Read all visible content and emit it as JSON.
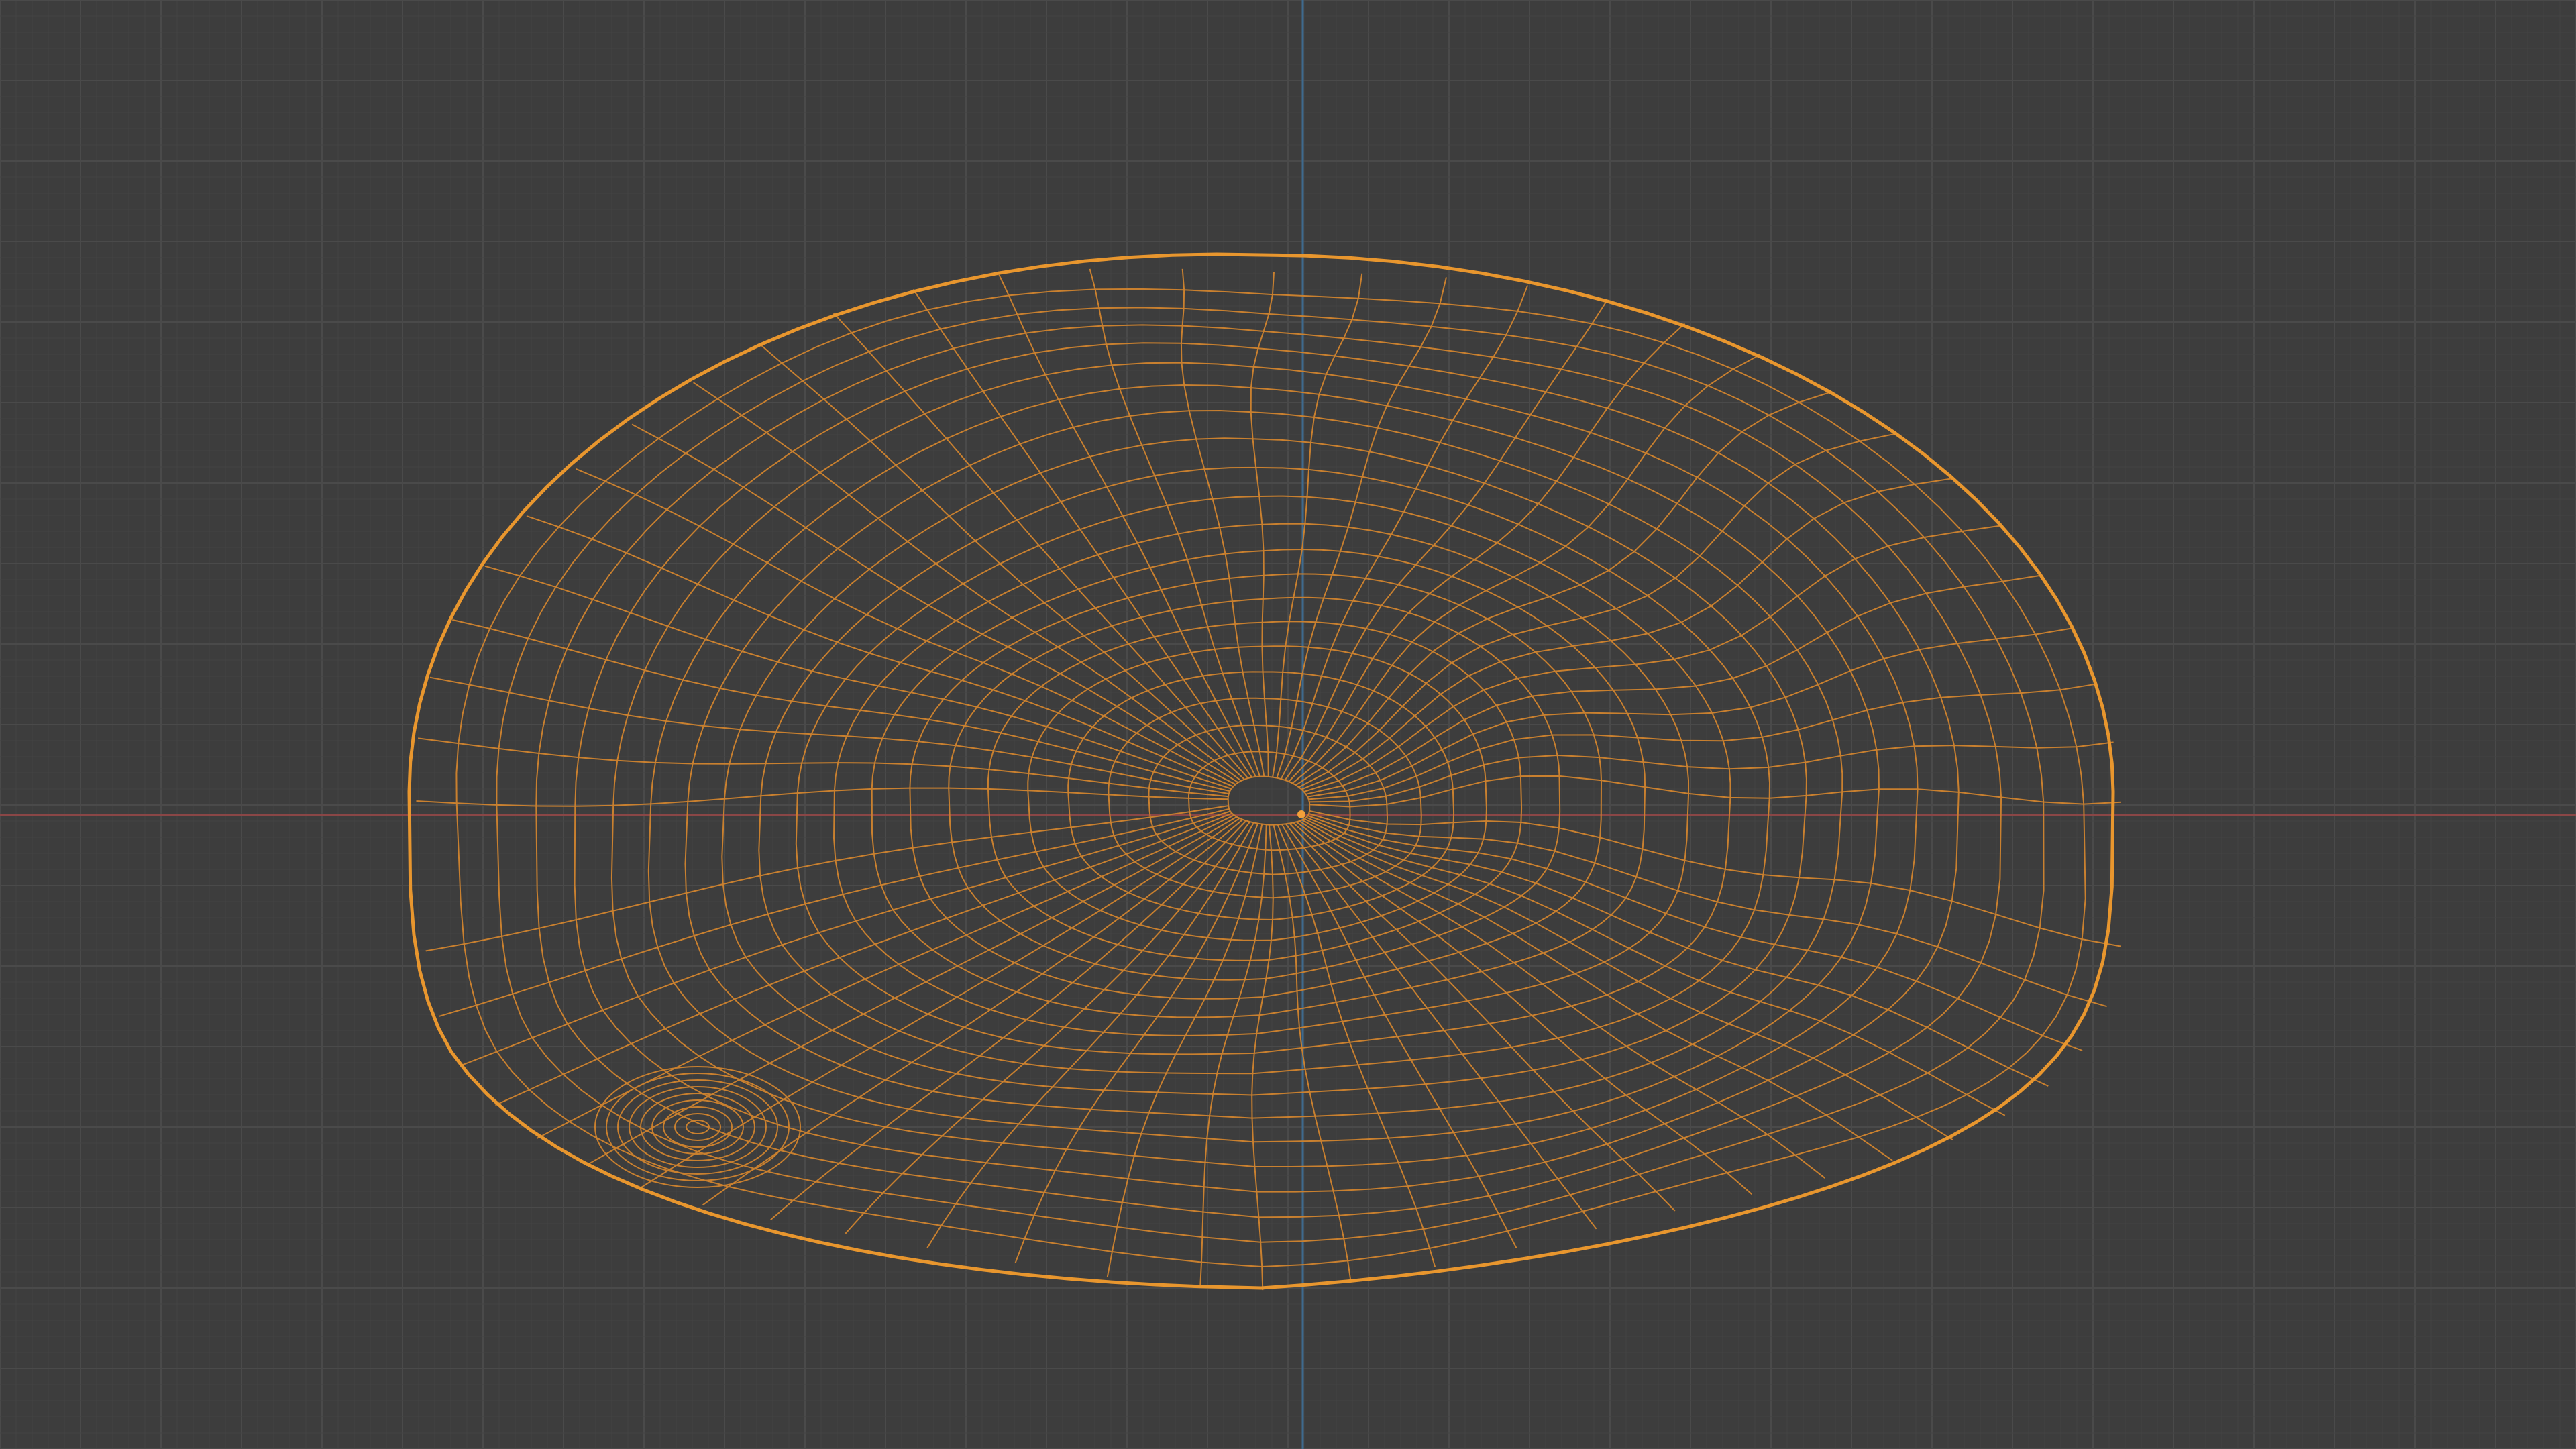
{
  "viewport": {
    "background_color": "#3d3d3d",
    "grid_minor_color": "#444444",
    "grid_major_color": "#4a4a4a",
    "x_axis_color": "#8a4646",
    "y_axis_color": "#3e6a8e",
    "wire_color": "#e8962e",
    "wire_inner_color": "#c9802f",
    "origin_marker_color": "#f2a03a"
  },
  "mesh": {
    "name": "",
    "display_mode": "wireframe",
    "selected": true,
    "icon": "mesh-icon"
  }
}
